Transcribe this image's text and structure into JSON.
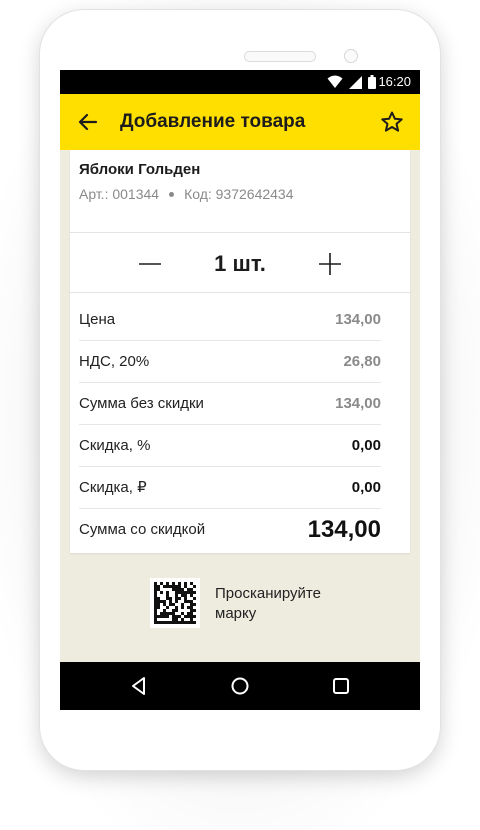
{
  "status_bar": {
    "time": "16:20",
    "icons": [
      "wifi-icon",
      "signal-icon",
      "battery-icon"
    ]
  },
  "app_bar": {
    "title": "Добавление товара",
    "back_icon": "arrow-left-icon",
    "favorite_icon": "star-outline-icon",
    "color": "#ffdf00"
  },
  "product": {
    "name": "Яблоки Гольден",
    "article": "Арт.: 001344",
    "code": "Код: 9372642434"
  },
  "quantity": {
    "value": "1 шт.",
    "minus_icon": "minus-icon",
    "plus_icon": "plus-icon"
  },
  "details": [
    {
      "label": "Цена",
      "value": "134,00",
      "style": "muted"
    },
    {
      "label": "НДС, 20%",
      "value": "26,80",
      "style": "muted"
    },
    {
      "label": "Сумма без скидки",
      "value": "134,00",
      "style": "muted"
    },
    {
      "label": "Скидка, %",
      "value": "0,00",
      "style": "strong"
    },
    {
      "label": "Скидка, ₽",
      "value": "0,00",
      "style": "strong"
    }
  ],
  "total": {
    "label": "Сумма со скидкой",
    "value": "134,00"
  },
  "scan": {
    "icon": "datamatrix-code-icon",
    "line1": "Просканируйте",
    "line2": "марку"
  },
  "nav_bar": {
    "icons": [
      "back-triangle-icon",
      "home-circle-icon",
      "recents-square-icon"
    ]
  },
  "colors": {
    "accent": "#ffdf00",
    "background": "#eeebdf",
    "muted_text": "#8a8a8a"
  }
}
